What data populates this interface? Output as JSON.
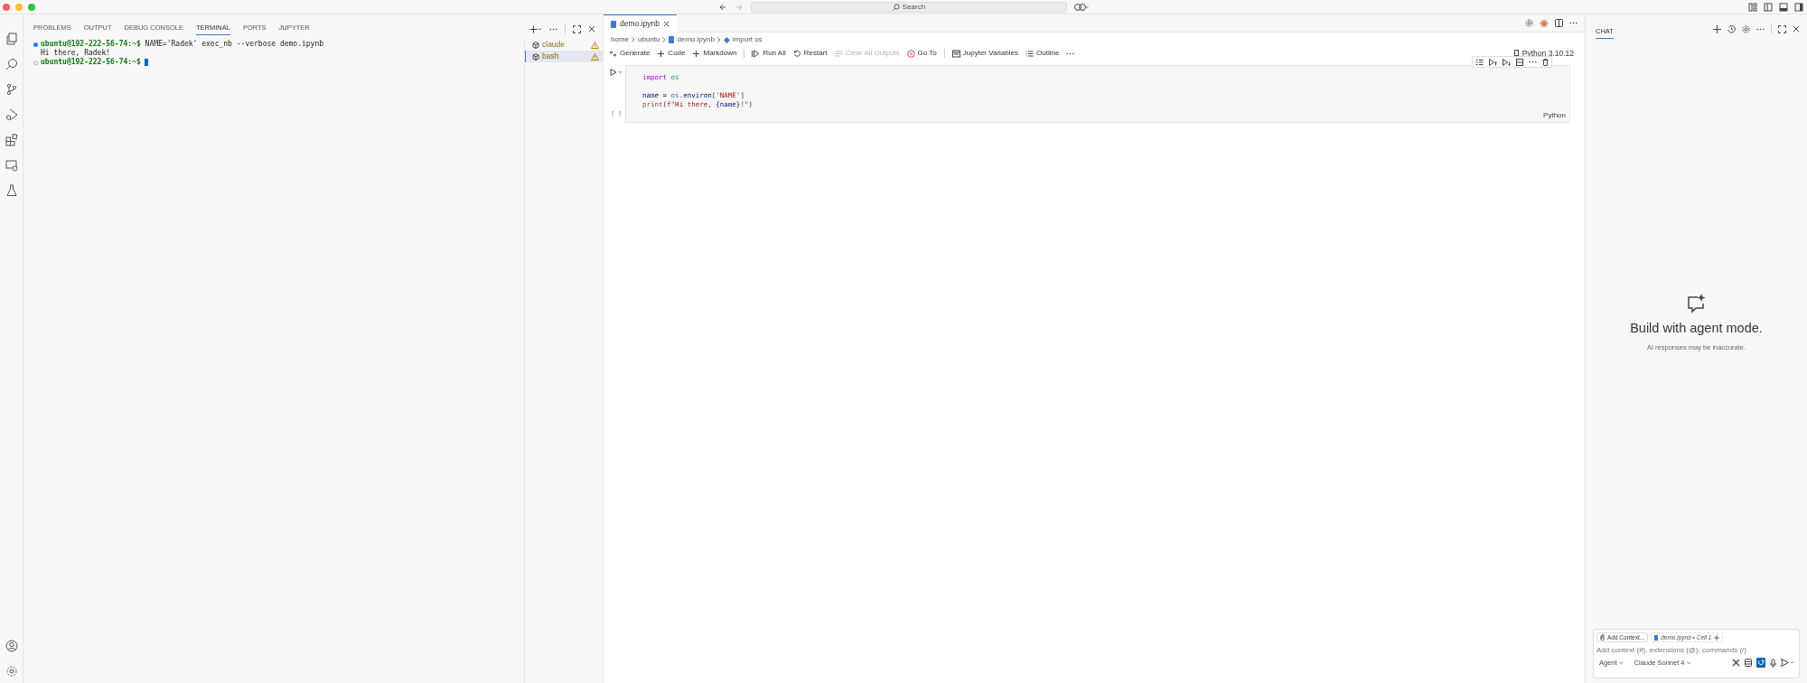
{
  "title_bar": {
    "search": {
      "placeholder": "Search"
    }
  },
  "panel": {
    "tabs": [
      {
        "label": "PROBLEMS",
        "selected": false
      },
      {
        "label": "OUTPUT",
        "selected": false
      },
      {
        "label": "DEBUG CONSOLE",
        "selected": false
      },
      {
        "label": "TERMINAL",
        "selected": true
      },
      {
        "label": "PORTS",
        "selected": false
      },
      {
        "label": "JUPYTER",
        "selected": false
      }
    ],
    "terminal_lines": [
      {
        "kind": "command",
        "succeeded": true,
        "prompt": "ubuntu@192-222-56-74:~$",
        "command": " NAME='Radek' exec_nb --verbose demo.ipynb"
      },
      {
        "kind": "output",
        "text": "Hi there, Radek!"
      },
      {
        "kind": "command",
        "succeeded": false,
        "prompt": "ubuntu@192-222-56-74:~$",
        "cursor": true
      }
    ],
    "terminals": [
      {
        "name": "claude",
        "selected": false,
        "warning": true
      },
      {
        "name": "bash",
        "selected": true,
        "warning": true
      }
    ]
  },
  "editor": {
    "tabs": [
      {
        "label": "demo.ipynb",
        "selected": true
      }
    ],
    "breadcrumbs": [
      {
        "kind": "folder",
        "text": "home"
      },
      {
        "kind": "folder",
        "text": "ubuntu"
      },
      {
        "kind": "file",
        "text": "demo.ipynb"
      },
      {
        "kind": "symbol",
        "text": "import os"
      }
    ],
    "toolbar": [
      {
        "kind": "generate",
        "label": "Generate",
        "disabled": false
      },
      {
        "kind": "code",
        "label": "Code",
        "disabled": false
      },
      {
        "kind": "markdown",
        "label": "Markdown",
        "disabled": false
      },
      {
        "kind": "run-all",
        "label": "Run All",
        "disabled": false
      },
      {
        "kind": "restart",
        "label": "Restart",
        "disabled": false
      },
      {
        "kind": "clear",
        "label": "Clear All Outputs",
        "disabled": true
      },
      {
        "kind": "goto",
        "label": "Go To",
        "disabled": false
      },
      {
        "kind": "variables",
        "label": "Jupyter Variables",
        "disabled": false
      },
      {
        "kind": "outline",
        "label": "Outline",
        "disabled": false
      }
    ],
    "kernel": "Python 3.10.12",
    "cell": {
      "execution": "[ ]",
      "language": "Python",
      "lines": [
        {
          "kind": "code",
          "tokens": [
            {
              "kind": "keyword",
              "text": "import "
            },
            {
              "kind": "module",
              "text": "os"
            }
          ]
        },
        {
          "kind": "blank"
        },
        {
          "kind": "code",
          "tokens": [
            {
              "kind": "variable",
              "text": "name"
            },
            {
              "kind": "plain",
              "text": " = "
            },
            {
              "kind": "module",
              "text": "os"
            },
            {
              "kind": "plain",
              "text": "."
            },
            {
              "kind": "variable",
              "text": "environ"
            },
            {
              "kind": "plain",
              "text": "["
            },
            {
              "kind": "string",
              "text": "'NAME'"
            },
            {
              "kind": "plain",
              "text": "]"
            }
          ]
        },
        {
          "kind": "code",
          "tokens": [
            {
              "kind": "function",
              "text": "print"
            },
            {
              "kind": "plain",
              "text": "("
            },
            {
              "kind": "string",
              "text": "f\"Hi there, "
            },
            {
              "kind": "variable",
              "text": "{name}"
            },
            {
              "kind": "string",
              "text": "!\""
            },
            {
              "kind": "plain",
              "text": ")"
            }
          ]
        }
      ]
    }
  },
  "chat": {
    "tab": {
      "label": "CHAT",
      "selected": true
    },
    "heading": "Build with agent mode.",
    "subtext": "AI responses may be inaccurate.",
    "attachments": [
      {
        "kind": "add",
        "label": "Add Context..."
      },
      {
        "kind": "file",
        "label": "demo.ipynb • Cell 1"
      }
    ],
    "input": {
      "placeholder": "Add context (#), extensions (@), commands (/)"
    },
    "mode": "Agent",
    "model": "Claude Sonnet 4"
  }
}
